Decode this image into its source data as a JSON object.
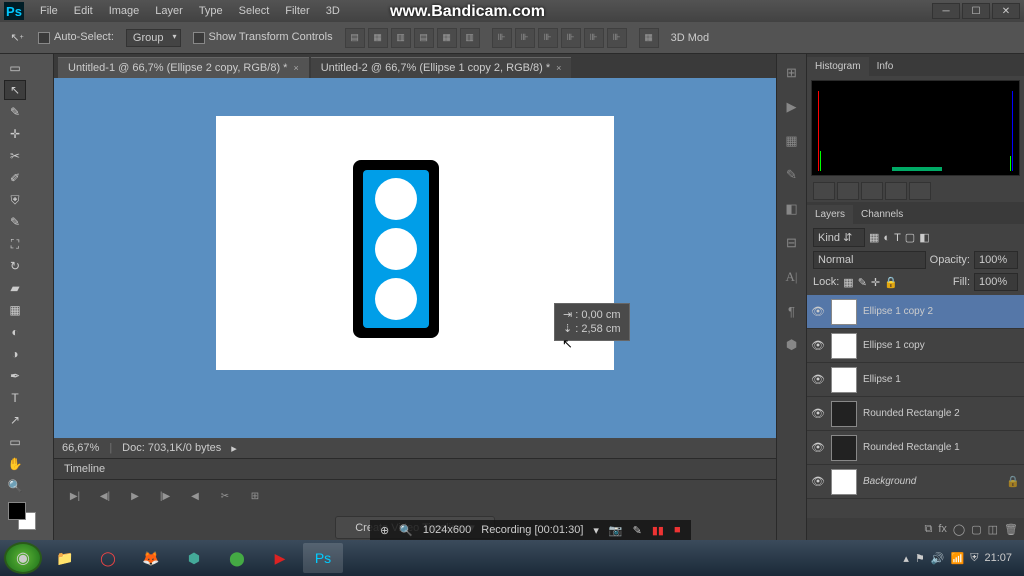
{
  "menu": {
    "file": "File",
    "edit": "Edit",
    "image": "Image",
    "layer": "Layer",
    "type": "Type",
    "select": "Select",
    "filter": "Filter",
    "threeD": "3D"
  },
  "watermark": "www.Bandicam.com",
  "options": {
    "autoSelect": "Auto-Select:",
    "group": "Group",
    "transform": "Show Transform Controls",
    "mode3d": "3D Mod"
  },
  "tabs": [
    {
      "label": "Untitled-1 @ 66,7% (Ellipse 2 copy, RGB/8) *"
    },
    {
      "label": "Untitled-2 @ 66,7% (Ellipse 1 copy 2, RGB/8) *"
    }
  ],
  "tooltip": {
    "w": "⇥ : 0,00 cm",
    "h": "⇣ : 2,58 cm"
  },
  "status": {
    "zoom": "66,67%",
    "doc": "Doc:",
    "size": "703,1K/0 bytes"
  },
  "timeline": {
    "label": "Timeline",
    "create": "Create Video Timeline"
  },
  "panels": {
    "histogram": "Histogram",
    "info": "Info",
    "layers": "Layers",
    "channels": "Channels",
    "kind": "Kind",
    "normal": "Normal",
    "opacity": "Opacity:",
    "opval": "100%",
    "lock": "Lock:",
    "fill": "Fill:",
    "fillval": "100%"
  },
  "layers": [
    {
      "name": "Ellipse 1 copy 2",
      "sel": true
    },
    {
      "name": "Ellipse 1 copy"
    },
    {
      "name": "Ellipse 1"
    },
    {
      "name": "Rounded Rectangle 2",
      "dark": true
    },
    {
      "name": "Rounded Rectangle 1",
      "dark": true
    },
    {
      "name": "Background",
      "locked": true,
      "italic": true
    }
  ],
  "bandicam": {
    "dims": "1024x600",
    "recording": "Recording [00:01:30]"
  },
  "tray": {
    "time": "21:07"
  }
}
